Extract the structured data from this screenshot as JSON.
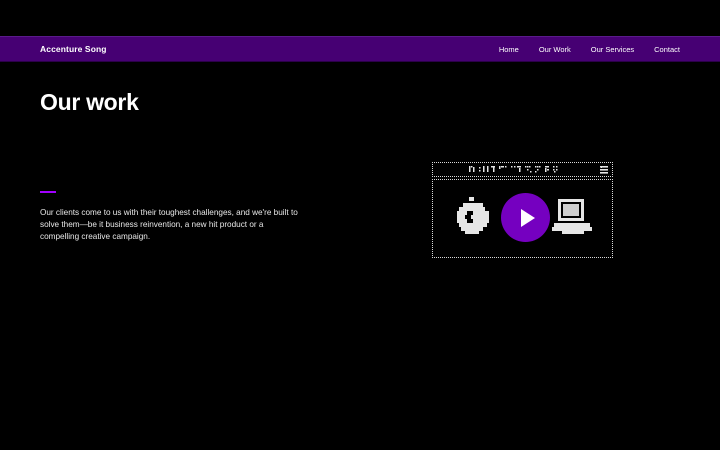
{
  "nav": {
    "brand": "Accenture Song",
    "links": [
      {
        "label": "Home"
      },
      {
        "label": "Our Work"
      },
      {
        "label": "Our Services"
      },
      {
        "label": "Contact"
      }
    ]
  },
  "main": {
    "title": "Our work",
    "intro": "Our clients come to us with their toughest challenges, and we're built to solve them—be it business reinvention, a new hit product or a compelling creative campaign."
  },
  "video": {
    "play_icon": "play-icon",
    "left_icon": "pixel-apple-icon",
    "right_icon": "pixel-computer-icon",
    "menu_icon": "pixel-menu-icon"
  },
  "colors": {
    "background": "#000000",
    "nav_background": "#460073",
    "accent": "#a100ff",
    "play_button": "#7500c0"
  }
}
